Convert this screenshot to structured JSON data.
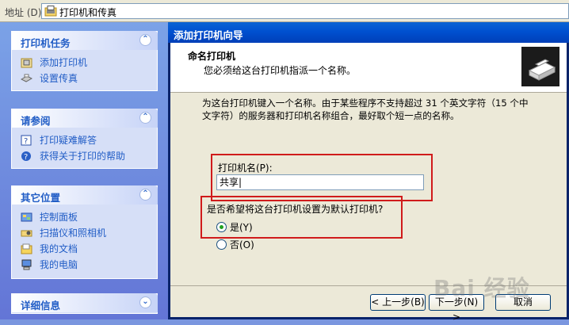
{
  "address_bar": {
    "label": "地址 (D)",
    "value": "打印机和传真",
    "icon": "printer-folder-icon"
  },
  "left_pane": {
    "panels": [
      {
        "title": "打印机任务",
        "chevron": "collapse",
        "items": [
          {
            "label": "添加打印机",
            "icon": "add-printer-icon"
          },
          {
            "label": "设置传真",
            "icon": "fax-icon"
          }
        ]
      },
      {
        "title": "请参阅",
        "chevron": "collapse",
        "items": [
          {
            "label": "打印疑难解答",
            "icon": "help-book-icon"
          },
          {
            "label": "获得关于打印的帮助",
            "icon": "help-icon"
          }
        ]
      },
      {
        "title": "其它位置",
        "chevron": "collapse",
        "items": [
          {
            "label": "控制面板",
            "icon": "control-panel-icon"
          },
          {
            "label": "扫描仪和照相机",
            "icon": "scanner-icon"
          },
          {
            "label": "我的文档",
            "icon": "my-documents-icon"
          },
          {
            "label": "我的电脑",
            "icon": "my-computer-icon"
          }
        ]
      },
      {
        "title": "详细信息",
        "chevron": "expand",
        "items": []
      }
    ]
  },
  "dialog": {
    "title": "添加打印机向导",
    "header": {
      "title": "命名打印机",
      "subtitle": "您必须给这台打印机指派一个名称。",
      "icon": "printer-icon"
    },
    "body_text": "为这台打印机键入一个名称。由于某些程序不支持超过 31 个英文字符（15 个中文字符）的服务器和打印机名称组合，最好取个短一点的名称。",
    "printer_name_label": "打印机名(P):",
    "printer_name_value": "共享",
    "default_question": "是否希望将这台打印机设置为默认打印机?",
    "radio_yes": "是(Y)",
    "radio_no": "否(O)",
    "selected": "yes",
    "buttons": {
      "back": "< 上一步(B)",
      "next": "下一步(N) >",
      "cancel": "取消"
    }
  },
  "watermark": "Bai 经验"
}
